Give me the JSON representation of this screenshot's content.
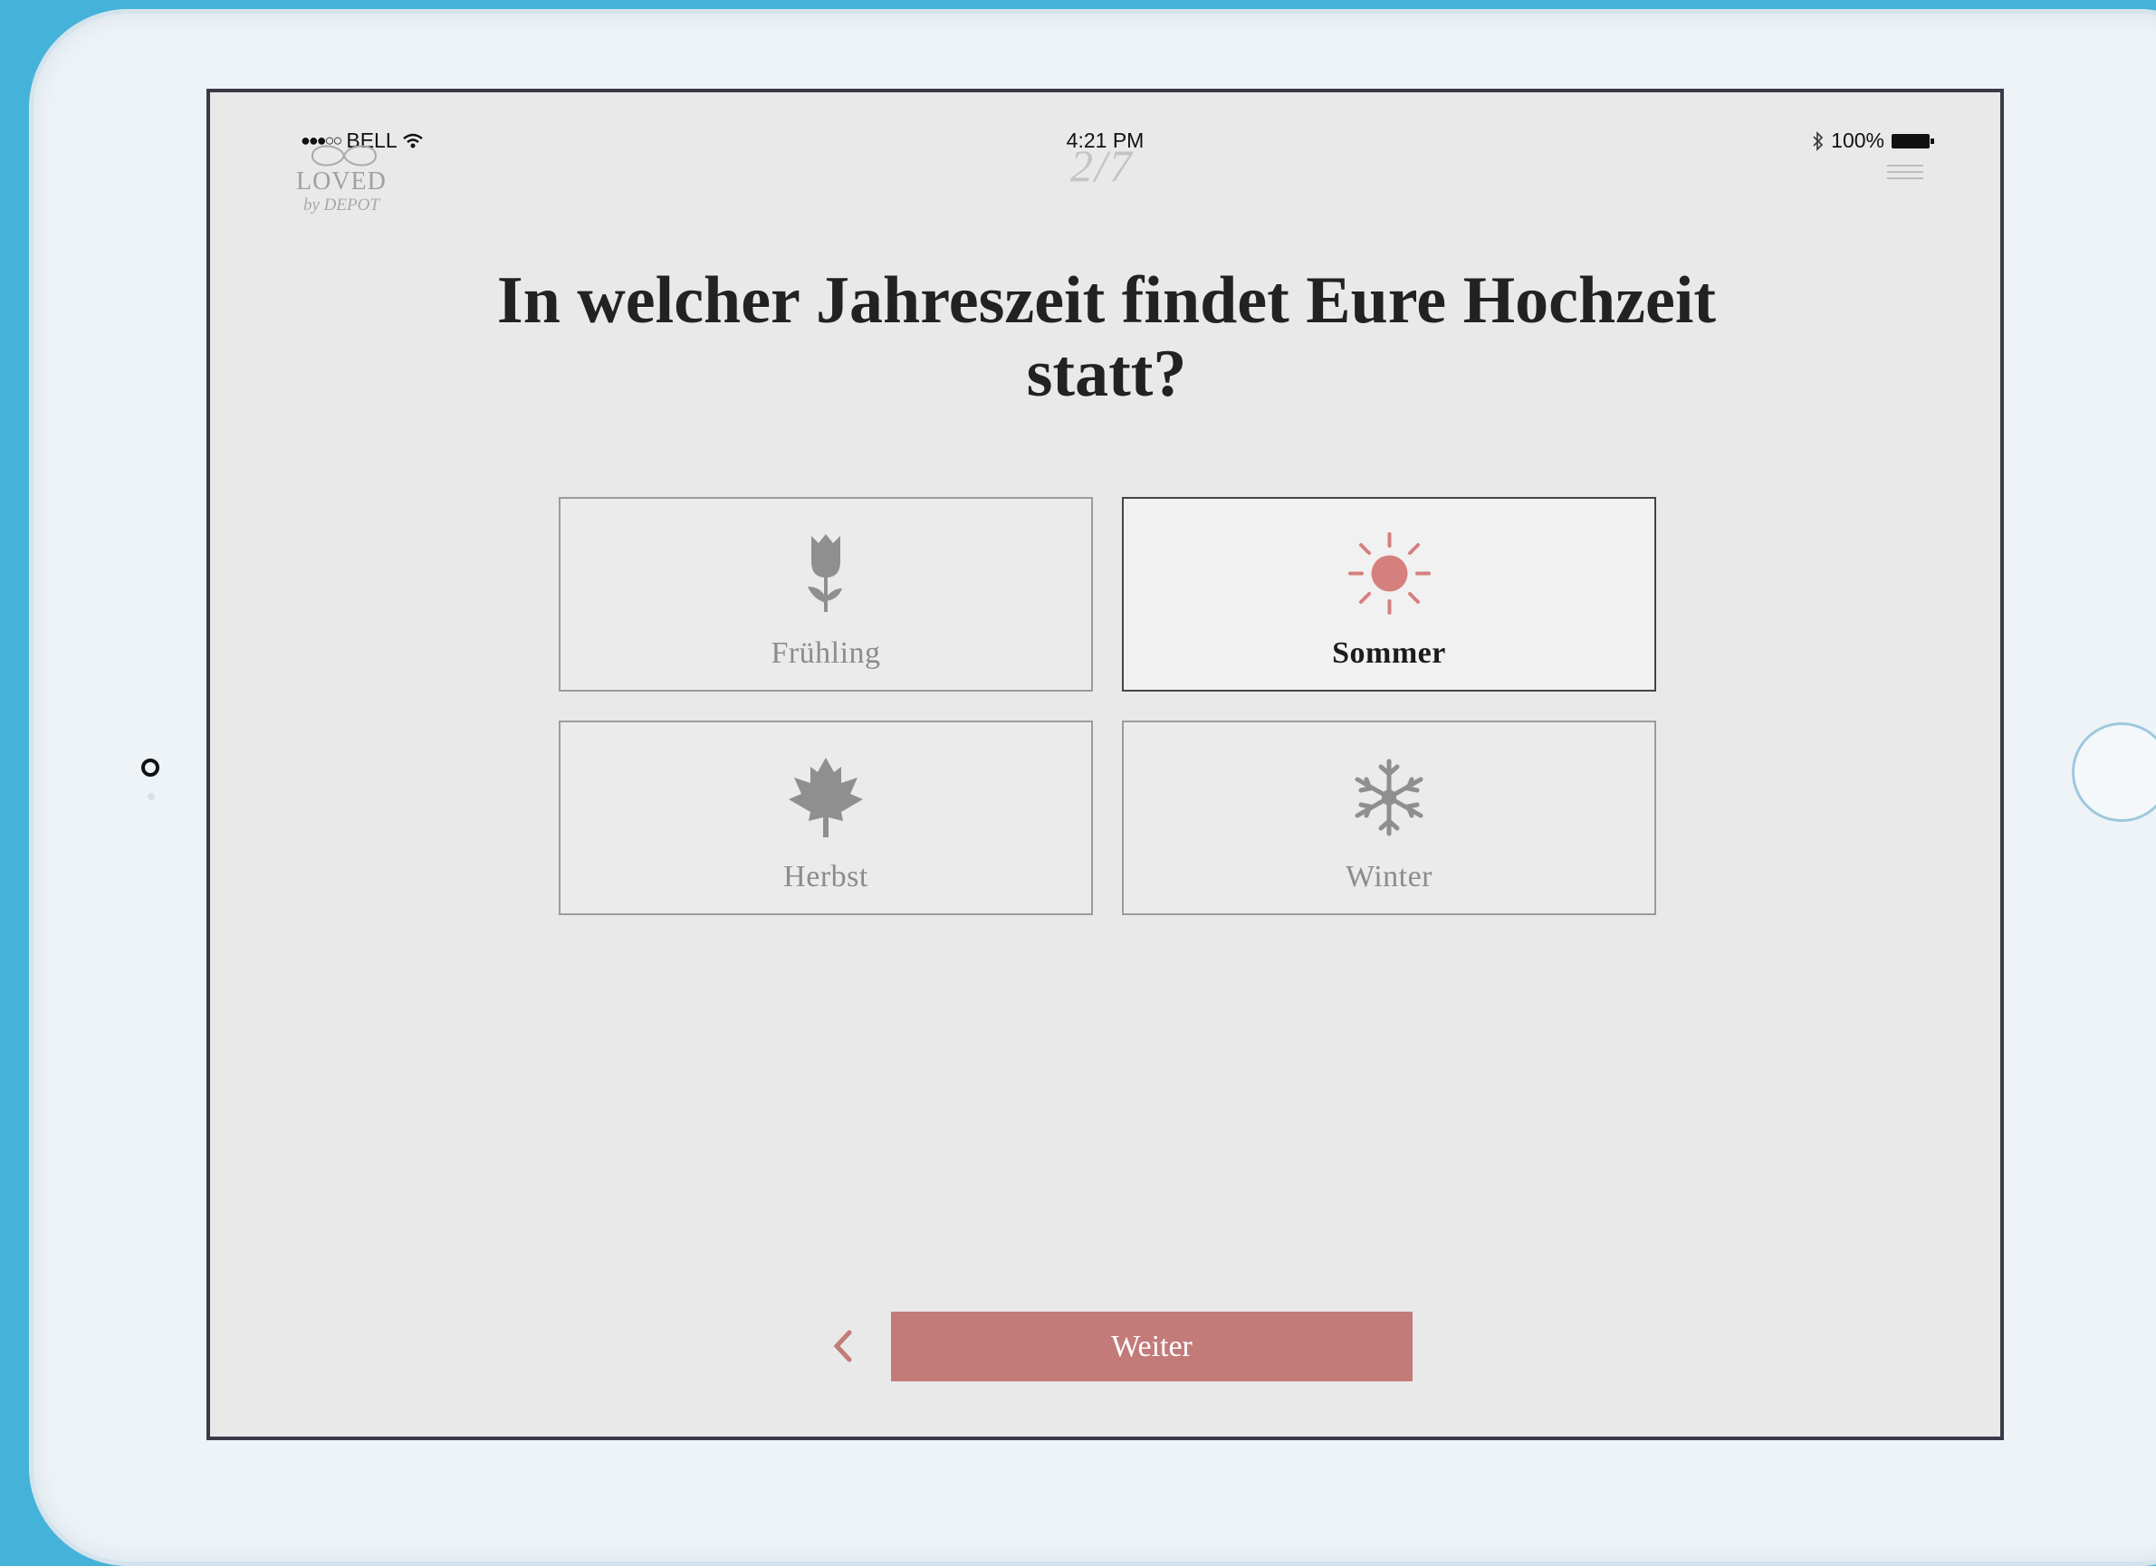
{
  "status_bar": {
    "carrier": "BELL",
    "time": "4:21 PM",
    "battery": "100%"
  },
  "logo": {
    "line1": "LOVED",
    "line2": "by DEPOT"
  },
  "step_indicator": "2/7",
  "question": "In welcher Jahreszeit findet Eure Hochzeit statt?",
  "options": [
    {
      "label": "Frühling",
      "icon": "tulip-icon",
      "selected": false
    },
    {
      "label": "Sommer",
      "icon": "sun-icon",
      "selected": true
    },
    {
      "label": "Herbst",
      "icon": "maple-leaf-icon",
      "selected": false
    },
    {
      "label": "Winter",
      "icon": "snowflake-icon",
      "selected": false
    }
  ],
  "nav": {
    "next_label": "Weiter",
    "back_icon": "chevron-left-icon"
  },
  "colors": {
    "accent": "#c27b79",
    "background": "#e9e9e9",
    "frame": "#45b3d9"
  }
}
